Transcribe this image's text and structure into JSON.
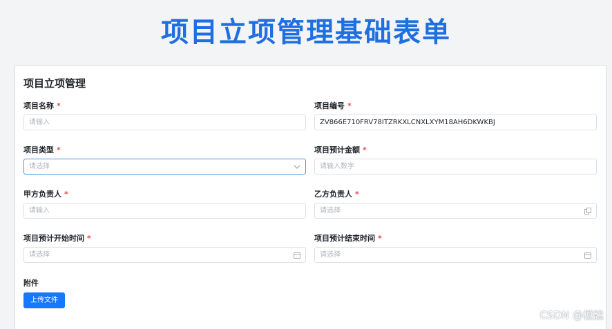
{
  "banner": {
    "title": "项目立项管理基础表单"
  },
  "form": {
    "title": "项目立项管理",
    "fields": [
      {
        "label": "项目名称",
        "required": "*",
        "value": "",
        "placeholder": "请输入"
      },
      {
        "label": "项目编号",
        "required": "*",
        "value": "ZV866E710FRV78ITZRKXLCNXLXYM18AH6DKWKBJ",
        "placeholder": ""
      },
      {
        "label": "项目类型",
        "required": "*",
        "value": "",
        "placeholder": "请选择",
        "icon": "chevron-down-icon"
      },
      {
        "label": "项目预计金额",
        "required": "*",
        "value": "",
        "placeholder": "请输入数字"
      },
      {
        "label": "甲方负责人",
        "required": "*",
        "value": "",
        "placeholder": "请输入"
      },
      {
        "label": "乙方负责人",
        "required": "*",
        "value": "",
        "placeholder": "请选择",
        "icon": "copy-icon"
      },
      {
        "label": "项目预计开始时间",
        "required": "*",
        "value": "",
        "placeholder": "请选择",
        "icon": "calendar-icon"
      },
      {
        "label": "项目预计结束时间",
        "required": "*",
        "value": "",
        "placeholder": "请选择",
        "icon": "calendar-icon"
      }
    ],
    "attachment": {
      "label": "附件",
      "upload_label": "上传文件"
    }
  },
  "colors": {
    "accent": "#1677ff",
    "banner": "#1f6fe0",
    "required": "#e5484d"
  },
  "watermark": "CSDN @橙諡"
}
